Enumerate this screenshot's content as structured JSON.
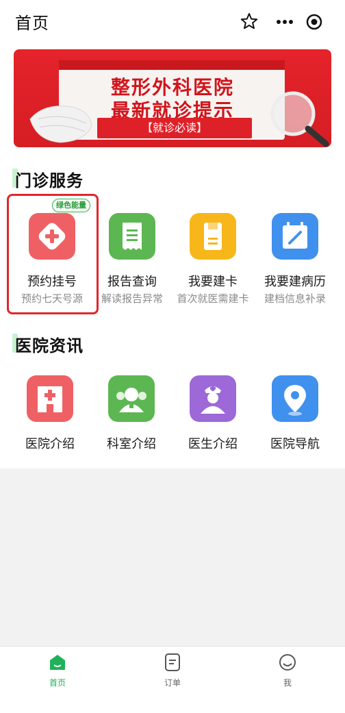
{
  "header": {
    "title": "首页"
  },
  "banner": {
    "line1": "整形外科医院",
    "line2": "最新就诊提示",
    "tag": "【就诊必读】"
  },
  "outpatient": {
    "title": "门诊服务",
    "badge": "绿色能量",
    "items": [
      {
        "label": "预约挂号",
        "sub": "预约七天号源",
        "icon": "plus-diamond-icon",
        "color": "#ef5f63"
      },
      {
        "label": "报告查询",
        "sub": "解读报告异常",
        "icon": "receipt-icon",
        "color": "#59b54f"
      },
      {
        "label": "我要建卡",
        "sub": "首次就医需建卡",
        "icon": "card-icon",
        "color": "#f7b718"
      },
      {
        "label": "我要建病历",
        "sub": "建档信息补录",
        "icon": "calendar-edit-icon",
        "color": "#3f8ef0"
      }
    ]
  },
  "news": {
    "title": "医院资讯",
    "items": [
      {
        "label": "医院介绍",
        "icon": "hospital-icon",
        "color": "#ef5f63"
      },
      {
        "label": "科室介绍",
        "icon": "doctor-team-icon",
        "color": "#59b54f"
      },
      {
        "label": "医生介绍",
        "icon": "nurse-icon",
        "color": "#9b66d6"
      },
      {
        "label": "医院导航",
        "icon": "location-pin-icon",
        "color": "#3f8ef0"
      }
    ]
  },
  "tabbar": {
    "tabs": [
      {
        "label": "首页",
        "icon": "home-icon",
        "active": true
      },
      {
        "label": "订单",
        "icon": "order-icon",
        "active": false
      },
      {
        "label": "我",
        "icon": "user-face-icon",
        "active": false
      }
    ]
  },
  "colors": {
    "accent": "#20b25a",
    "highlight": "#e0262a",
    "banner": "#e5232a"
  }
}
